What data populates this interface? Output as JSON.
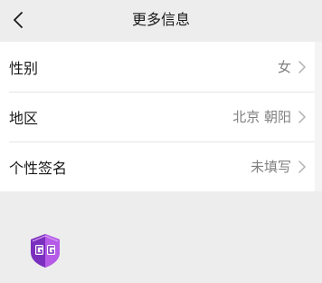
{
  "nav": {
    "title": "更多信息",
    "back_icon": "chevron-left-icon"
  },
  "rows": [
    {
      "label": "性别",
      "value": "女",
      "icon": "chevron-right-icon"
    },
    {
      "label": "地区",
      "value": "北京 朝阳",
      "icon": "chevron-right-icon"
    },
    {
      "label": "个性签名",
      "value": "未填写",
      "icon": "chevron-right-icon"
    }
  ],
  "floating_app": {
    "icon": "game-guardian-icon",
    "badge_text": "GG",
    "colors": {
      "primary": "#7b2fbf",
      "secondary": "#b65be8"
    }
  },
  "colors": {
    "page_background": "#ededed",
    "card_background": "#ffffff",
    "text_primary": "#191919",
    "text_secondary": "#7f7f7f"
  }
}
